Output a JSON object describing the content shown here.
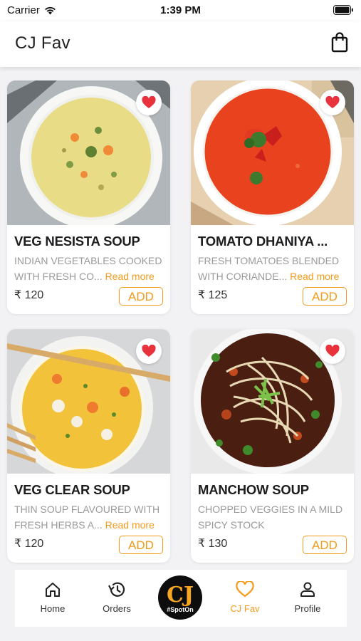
{
  "status": {
    "carrier": "Carrier",
    "time": "1:39 PM"
  },
  "header": {
    "title": "CJ Fav"
  },
  "currency_symbol": "₹",
  "items": [
    {
      "name": "VEG NESISTA SOUP",
      "desc_line1": "INDIAN VEGETABLES COOKED",
      "desc_line2": "WITH FRESH CO...",
      "read_more": "Read more",
      "price": "₹ 120",
      "add_label": "ADD"
    },
    {
      "name": "TOMATO DHANIYA ...",
      "desc_line1": "FRESH TOMATOES BLENDED",
      "desc_line2": "WITH CORIANDE...",
      "read_more": "Read more",
      "price": "₹ 125",
      "add_label": "ADD"
    },
    {
      "name": "VEG CLEAR SOUP",
      "desc_line1": "THIN SOUP FLAVOURED WITH",
      "desc_line2": "FRESH HERBS A...",
      "read_more": "Read more",
      "price": "₹ 120",
      "add_label": "ADD"
    },
    {
      "name": "MANCHOW SOUP",
      "desc_line1": "CHOPPED VEGGIES IN A MILD",
      "desc_line2": "SPICY STOCK",
      "read_more": "",
      "price": "₹ 130",
      "add_label": "ADD"
    }
  ],
  "tabs": [
    {
      "label": "Home",
      "icon": "home-icon"
    },
    {
      "label": "Orders",
      "icon": "history-icon"
    },
    {
      "label": "#SpotOn",
      "icon": "cj-logo"
    },
    {
      "label": "CJ Fav",
      "icon": "heart-icon"
    },
    {
      "label": "Profile",
      "icon": "profile-icon"
    }
  ],
  "logo": {
    "letters": "CJ",
    "tag": "#SpotOn"
  },
  "colors": {
    "accent": "#f39a1a",
    "heart": "#e8323c",
    "text_dark": "#1d1d1f",
    "text_muted": "#9a9a9a"
  }
}
